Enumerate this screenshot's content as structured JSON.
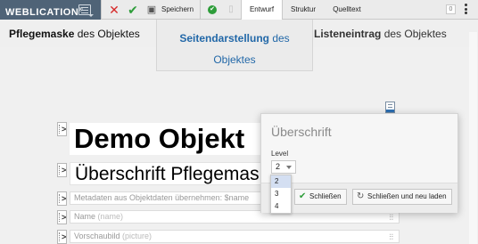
{
  "toolbar": {
    "brand": "WEBLICATION",
    "brand_mark": "®",
    "save_label": "Speichern",
    "tabs": [
      {
        "label": "Entwurf",
        "active": true
      },
      {
        "label": "Struktur",
        "active": false
      },
      {
        "label": "Quelltext",
        "active": false
      }
    ],
    "counter": "0",
    "colors": {
      "brand_bg": "#4f6377",
      "cancel": "#d62828",
      "check": "#2e9d3a",
      "disk": "#555555"
    }
  },
  "view_tabs": {
    "left": {
      "bold": "Pflegemaske",
      "rest": " des Objektes"
    },
    "center": {
      "bold": "Seitendarstellung",
      "rest": " des",
      "line2": "Objektes",
      "color": "#2268a8"
    },
    "right": {
      "bold": "Listeneintrag",
      "rest": " des Objektes"
    }
  },
  "content": {
    "heading_big": "Demo Objekt",
    "heading_sub": "Überschrift Pflegemas",
    "fields": [
      {
        "label": "Metadaten aus Objektdaten übernehmen: $name",
        "sub": ""
      },
      {
        "label": "Name",
        "sub": " (name)"
      },
      {
        "label": "Vorschaubild",
        "sub": " (picture)"
      }
    ]
  },
  "dialog": {
    "title": "Überschrift",
    "level_label": "Level",
    "level_value": "2",
    "options": [
      "2",
      "3",
      "4"
    ],
    "buttons": {
      "close": "Schließen",
      "close_reload": "Schließen und neu laden"
    }
  }
}
